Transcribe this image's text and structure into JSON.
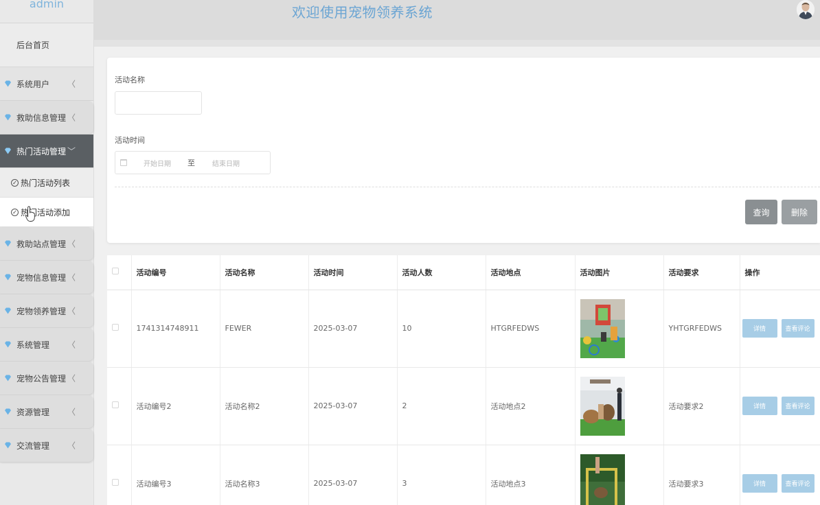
{
  "sidebar": {
    "brand": "admin",
    "home": "后台首页",
    "items": [
      {
        "label": "系统用户",
        "arrow": "〈"
      },
      {
        "label": "救助信息管理",
        "arrow": "〈"
      },
      {
        "label": "热门活动管理",
        "arrow": "〈"
      },
      {
        "label": "救助站点管理",
        "arrow": "〈"
      },
      {
        "label": "宠物信息管理",
        "arrow": "〈"
      },
      {
        "label": "宠物领养管理",
        "arrow": "〈"
      },
      {
        "label": "系统管理",
        "arrow": "〈"
      },
      {
        "label": "宠物公告管理",
        "arrow": "〈"
      },
      {
        "label": "资源管理",
        "arrow": "〈"
      },
      {
        "label": "交流管理",
        "arrow": "〈"
      }
    ],
    "submenu": [
      {
        "label": "热门活动列表"
      },
      {
        "label": "热门活动添加"
      }
    ],
    "accent": "#6ab3e6"
  },
  "header": {
    "title": "欢迎使用宠物领养系统"
  },
  "search": {
    "name_label": "活动名称",
    "name_value": "",
    "time_label": "活动时间",
    "start_placeholder": "开始日期",
    "separator": "至",
    "end_placeholder": "结束日期",
    "query_button": "查询",
    "delete_button": "删除"
  },
  "table": {
    "headers": [
      "活动编号",
      "活动名称",
      "活动时间",
      "活动人数",
      "活动地点",
      "活动图片",
      "活动要求",
      "操作"
    ],
    "rows": [
      {
        "id": "1741314748911",
        "name": "FEWER",
        "time": "2025-03-07",
        "count": "10",
        "place": "HTGRFEDWS",
        "image": "activity-photo-1",
        "req": "YHTGRFEDWS"
      },
      {
        "id": "活动编号2",
        "name": "活动名称2",
        "time": "2025-03-07",
        "count": "2",
        "place": "活动地点2",
        "image": "activity-photo-2",
        "req": "活动要求2"
      },
      {
        "id": "活动编号3",
        "name": "活动名称3",
        "time": "2025-03-07",
        "count": "3",
        "place": "活动地点3",
        "image": "activity-photo-3",
        "req": "活动要求3"
      }
    ],
    "detail_button": "详情",
    "comment_button": "查看评论"
  }
}
